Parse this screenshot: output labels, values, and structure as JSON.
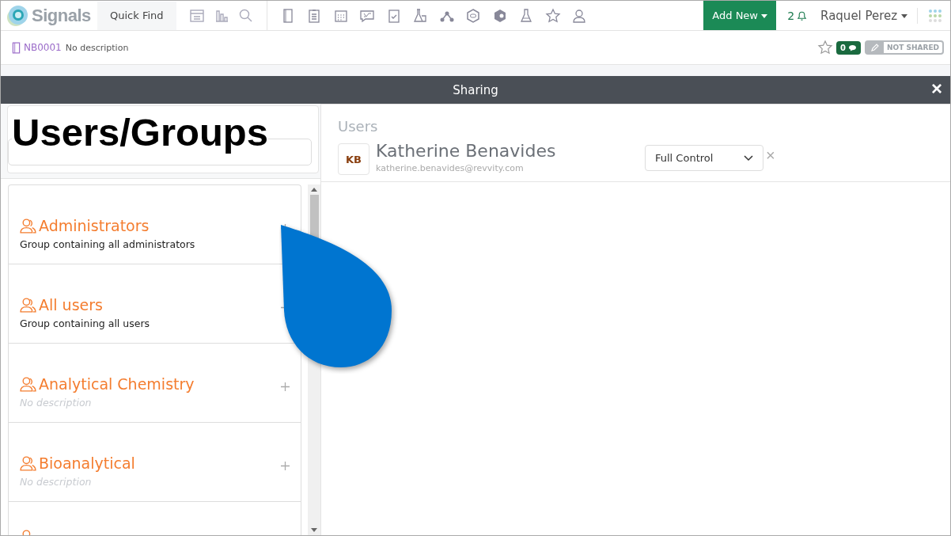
{
  "topbar": {
    "brand": "Signals",
    "quick_find": "Quick Find",
    "add_new": "Add New",
    "notifications": "2",
    "user": "Raquel Perez"
  },
  "notebook": {
    "id": "NB0001",
    "description": "No description",
    "comments": "0",
    "sharing": "NOT SHARED"
  },
  "dialog": {
    "title": "Sharing",
    "close": "×"
  },
  "annotation": {
    "label": "Users/Groups"
  },
  "groups": [
    {
      "name": "Administrators",
      "description": "Group containing all administrators",
      "kind": "described"
    },
    {
      "name": "All users",
      "description": "Group containing all users",
      "kind": "described"
    },
    {
      "name": "Analytical Chemistry",
      "description": "No description",
      "kind": "undescribed"
    },
    {
      "name": "Bioanalytical",
      "description": "No description",
      "kind": "undescribed"
    }
  ],
  "users_heading": "Users",
  "users": [
    {
      "initials": "KB",
      "name": "Katherine Benavides",
      "email": "katherine.benavides@revvity.com",
      "permission": "Full Control",
      "remove": "×"
    }
  ]
}
